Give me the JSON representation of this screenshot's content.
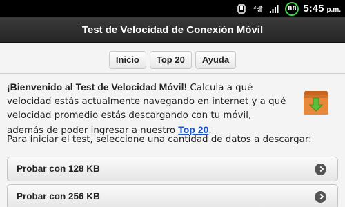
{
  "status": {
    "battery": "88",
    "time": "5:45",
    "ampm": "p.m."
  },
  "header": {
    "title": "Test de Velocidad de Conexión Móvil"
  },
  "nav": [
    "Inicio",
    "Top 20",
    "Ayuda"
  ],
  "intro": {
    "heading": "¡Bienvenido al Test de Velocidad Móvil!",
    "body": " Calcula a qué velocidad estás actualmente navegando en internet y a qué velocidad promedio estás descargando con tu móvil, además de poder ingresar a nuestro ",
    "link": "Top 20",
    "end": "."
  },
  "prompt": "Para iniciar el test, seleccione una cantidad de datos a descargar:",
  "options": [
    "Probar con 128 KB",
    "Probar con 256 KB"
  ],
  "colors": {
    "battery_ring": "#3ad34a",
    "link": "#1a56c8",
    "icon_box": "#e8883a",
    "icon_arrow": "#5cbf3a"
  }
}
